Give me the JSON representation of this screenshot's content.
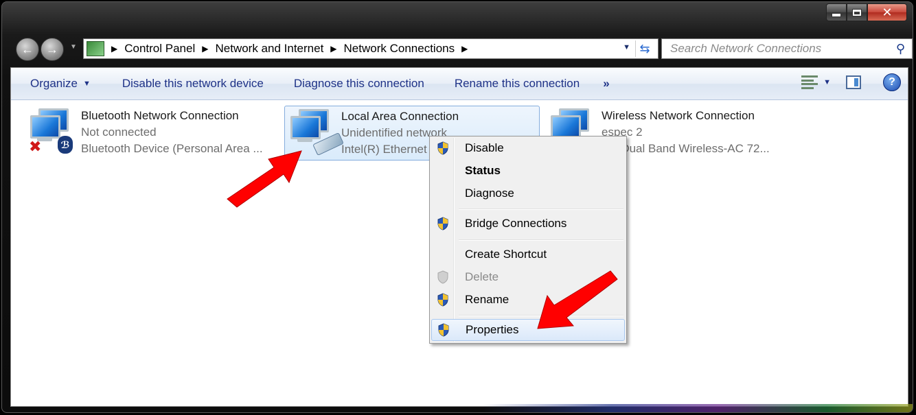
{
  "window": {
    "caption": {
      "minimize": "",
      "maximize": "",
      "close": "✕"
    }
  },
  "navbar": {
    "back_icon": "arrow-left-icon",
    "forward_icon": "arrow-right-icon",
    "breadcrumbs": [
      "Control Panel",
      "Network and Internet",
      "Network Connections"
    ],
    "search_placeholder": "Search Network Connections"
  },
  "toolbar": {
    "organize": "Organize",
    "disable": "Disable this network device",
    "diagnose": "Diagnose this connection",
    "rename": "Rename this connection",
    "more": "»"
  },
  "connections": [
    {
      "name": "Bluetooth Network Connection",
      "status": "Not connected",
      "device": "Bluetooth Device (Personal Area ..."
    },
    {
      "name": "Local Area Connection",
      "status": "Unidentified network",
      "device": "Intel(R) Ethernet"
    },
    {
      "name": "Wireless Network Connection",
      "status": "espec  2",
      "device": "(R) Dual Band Wireless-AC 72..."
    }
  ],
  "context_menu": {
    "items": [
      "Disable",
      "Status",
      "Diagnose",
      "Bridge Connections",
      "Create Shortcut",
      "Delete",
      "Rename",
      "Properties"
    ]
  },
  "colors": {
    "toolbar_text": "#1e3287",
    "annotation_arrow": "#ff0000",
    "selection_border": "#84acdd"
  }
}
